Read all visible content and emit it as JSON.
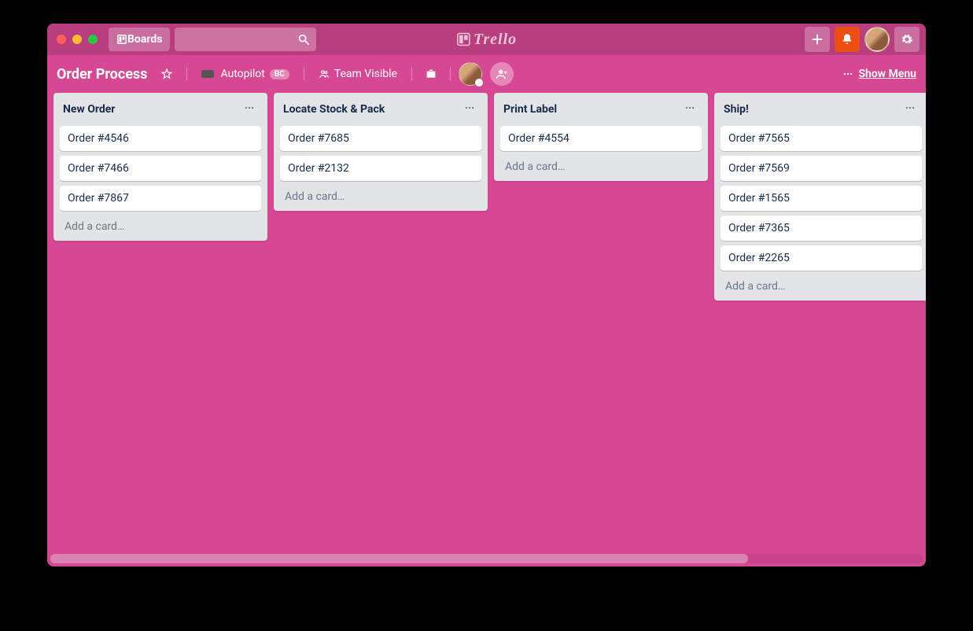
{
  "header": {
    "boards_label": "Boards",
    "logo_text": "Trello"
  },
  "board": {
    "title": "Order Process",
    "team_name": "Autopilot",
    "team_badge": "BC",
    "visibility_label": "Team Visible",
    "show_menu_label": "Show Menu"
  },
  "add_card_label": "Add a card…",
  "lists": [
    {
      "title": "New Order",
      "cards": [
        "Order #4546",
        "Order #7466",
        "Order #7867"
      ]
    },
    {
      "title": "Locate Stock & Pack",
      "cards": [
        "Order #7685",
        "Order #2132"
      ]
    },
    {
      "title": "Print Label",
      "cards": [
        "Order #4554"
      ]
    },
    {
      "title": "Ship!",
      "cards": [
        "Order #7565",
        "Order #7569",
        "Order #1565",
        "Order #7365",
        "Order #2265"
      ]
    }
  ]
}
